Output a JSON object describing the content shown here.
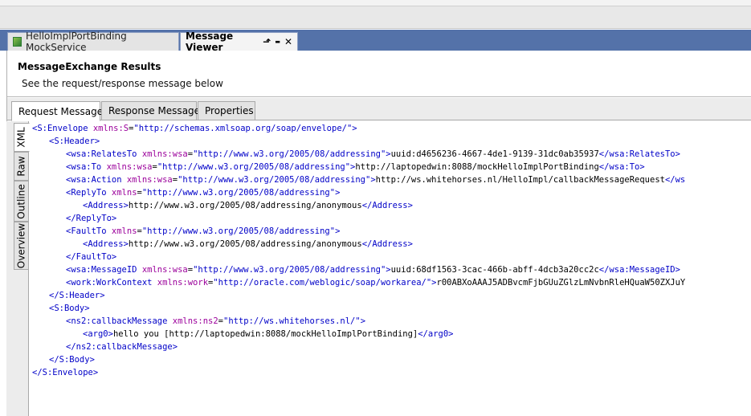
{
  "editor_tabs": [
    {
      "label": "HelloImplPortBinding MockService",
      "active": false
    },
    {
      "label": "Message Viewer",
      "active": true
    }
  ],
  "editor_tab_controls": {
    "pin": "⬏",
    "minimize": "▬",
    "close": "✕"
  },
  "header": {
    "title": "MessageExchange Results",
    "subtitle": "See the request/response message below"
  },
  "sub_tabs": [
    "Request Message",
    "Response Message",
    "Properties"
  ],
  "view_tabs": [
    "XML",
    "Raw",
    "Outline",
    "Overview"
  ],
  "xml_lines": [
    {
      "indent": 0,
      "parts": [
        {
          "t": "tg",
          "v": "<S:Envelope "
        },
        {
          "t": "at",
          "v": "xmlns:S"
        },
        {
          "t": "tx",
          "v": "="
        },
        {
          "t": "av",
          "v": "\"http://schemas.xmlsoap.org/soap/envelope/\""
        },
        {
          "t": "tg",
          "v": ">"
        }
      ]
    },
    {
      "indent": 1,
      "parts": [
        {
          "t": "tg",
          "v": "<S:Header>"
        }
      ]
    },
    {
      "indent": 2,
      "parts": [
        {
          "t": "tg",
          "v": "<wsa:RelatesTo "
        },
        {
          "t": "at",
          "v": "xmlns:wsa"
        },
        {
          "t": "tx",
          "v": "="
        },
        {
          "t": "av",
          "v": "\"http://www.w3.org/2005/08/addressing\""
        },
        {
          "t": "tg",
          "v": ">"
        },
        {
          "t": "tx",
          "v": "uuid:d4656236-4667-4de1-9139-31dc0ab35937"
        },
        {
          "t": "tg",
          "v": "</wsa:RelatesTo>"
        }
      ]
    },
    {
      "indent": 2,
      "parts": [
        {
          "t": "tg",
          "v": "<wsa:To "
        },
        {
          "t": "at",
          "v": "xmlns:wsa"
        },
        {
          "t": "tx",
          "v": "="
        },
        {
          "t": "av",
          "v": "\"http://www.w3.org/2005/08/addressing\""
        },
        {
          "t": "tg",
          "v": ">"
        },
        {
          "t": "tx",
          "v": "http://laptopedwin:8088/mockHelloImplPortBinding"
        },
        {
          "t": "tg",
          "v": "</wsa:To>"
        }
      ]
    },
    {
      "indent": 2,
      "parts": [
        {
          "t": "tg",
          "v": "<wsa:Action "
        },
        {
          "t": "at",
          "v": "xmlns:wsa"
        },
        {
          "t": "tx",
          "v": "="
        },
        {
          "t": "av",
          "v": "\"http://www.w3.org/2005/08/addressing\""
        },
        {
          "t": "tg",
          "v": ">"
        },
        {
          "t": "tx",
          "v": "http://ws.whitehorses.nl/HelloImpl/callbackMessageRequest"
        },
        {
          "t": "tg",
          "v": "</ws"
        }
      ]
    },
    {
      "indent": 2,
      "parts": [
        {
          "t": "tg",
          "v": "<ReplyTo "
        },
        {
          "t": "at",
          "v": "xmlns"
        },
        {
          "t": "tx",
          "v": "="
        },
        {
          "t": "av",
          "v": "\"http://www.w3.org/2005/08/addressing\""
        },
        {
          "t": "tg",
          "v": ">"
        }
      ]
    },
    {
      "indent": 3,
      "parts": [
        {
          "t": "tg",
          "v": "<Address>"
        },
        {
          "t": "tx",
          "v": "http://www.w3.org/2005/08/addressing/anonymous"
        },
        {
          "t": "tg",
          "v": "</Address>"
        }
      ]
    },
    {
      "indent": 2,
      "parts": [
        {
          "t": "tg",
          "v": "</ReplyTo>"
        }
      ]
    },
    {
      "indent": 2,
      "parts": [
        {
          "t": "tg",
          "v": "<FaultTo "
        },
        {
          "t": "at",
          "v": "xmlns"
        },
        {
          "t": "tx",
          "v": "="
        },
        {
          "t": "av",
          "v": "\"http://www.w3.org/2005/08/addressing\""
        },
        {
          "t": "tg",
          "v": ">"
        }
      ]
    },
    {
      "indent": 3,
      "parts": [
        {
          "t": "tg",
          "v": "<Address>"
        },
        {
          "t": "tx",
          "v": "http://www.w3.org/2005/08/addressing/anonymous"
        },
        {
          "t": "tg",
          "v": "</Address>"
        }
      ]
    },
    {
      "indent": 2,
      "parts": [
        {
          "t": "tg",
          "v": "</FaultTo>"
        }
      ]
    },
    {
      "indent": 2,
      "parts": [
        {
          "t": "tg",
          "v": "<wsa:MessageID "
        },
        {
          "t": "at",
          "v": "xmlns:wsa"
        },
        {
          "t": "tx",
          "v": "="
        },
        {
          "t": "av",
          "v": "\"http://www.w3.org/2005/08/addressing\""
        },
        {
          "t": "tg",
          "v": ">"
        },
        {
          "t": "tx",
          "v": "uuid:68df1563-3cac-466b-abff-4dcb3a20cc2c"
        },
        {
          "t": "tg",
          "v": "</wsa:MessageID>"
        }
      ]
    },
    {
      "indent": 2,
      "parts": [
        {
          "t": "tg",
          "v": "<work:WorkContext "
        },
        {
          "t": "at",
          "v": "xmlns:work"
        },
        {
          "t": "tx",
          "v": "="
        },
        {
          "t": "av",
          "v": "\"http://oracle.com/weblogic/soap/workarea/\""
        },
        {
          "t": "tg",
          "v": ">"
        },
        {
          "t": "tx",
          "v": "r00ABXoAAAJ5ADBvcmFjbGUuZGlzLmNvbnRleHQuaW50ZXJuY"
        }
      ]
    },
    {
      "indent": 1,
      "parts": [
        {
          "t": "tg",
          "v": "</S:Header>"
        }
      ]
    },
    {
      "indent": 1,
      "parts": [
        {
          "t": "tg",
          "v": "<S:Body>"
        }
      ]
    },
    {
      "indent": 2,
      "parts": [
        {
          "t": "tg",
          "v": "<ns2:callbackMessage "
        },
        {
          "t": "at",
          "v": "xmlns:ns2"
        },
        {
          "t": "tx",
          "v": "="
        },
        {
          "t": "av",
          "v": "\"http://ws.whitehorses.nl/\""
        },
        {
          "t": "tg",
          "v": ">"
        }
      ]
    },
    {
      "indent": 3,
      "parts": [
        {
          "t": "tg",
          "v": "<arg0>"
        },
        {
          "t": "tx",
          "v": "hello you [http://laptopedwin:8088/mockHelloImplPortBinding]"
        },
        {
          "t": "tg",
          "v": "</arg0>"
        }
      ]
    },
    {
      "indent": 2,
      "parts": [
        {
          "t": "tg",
          "v": "</ns2:callbackMessage>"
        }
      ]
    },
    {
      "indent": 1,
      "parts": [
        {
          "t": "tg",
          "v": "</S:Body>"
        }
      ]
    },
    {
      "indent": 0,
      "parts": [
        {
          "t": "tg",
          "v": "</S:Envelope>"
        }
      ]
    }
  ],
  "colors": {
    "tab_bar": "#5472a9",
    "xml_tag": "#0000c8",
    "xml_attr": "#9b009b",
    "xml_value": "#0000c8"
  }
}
